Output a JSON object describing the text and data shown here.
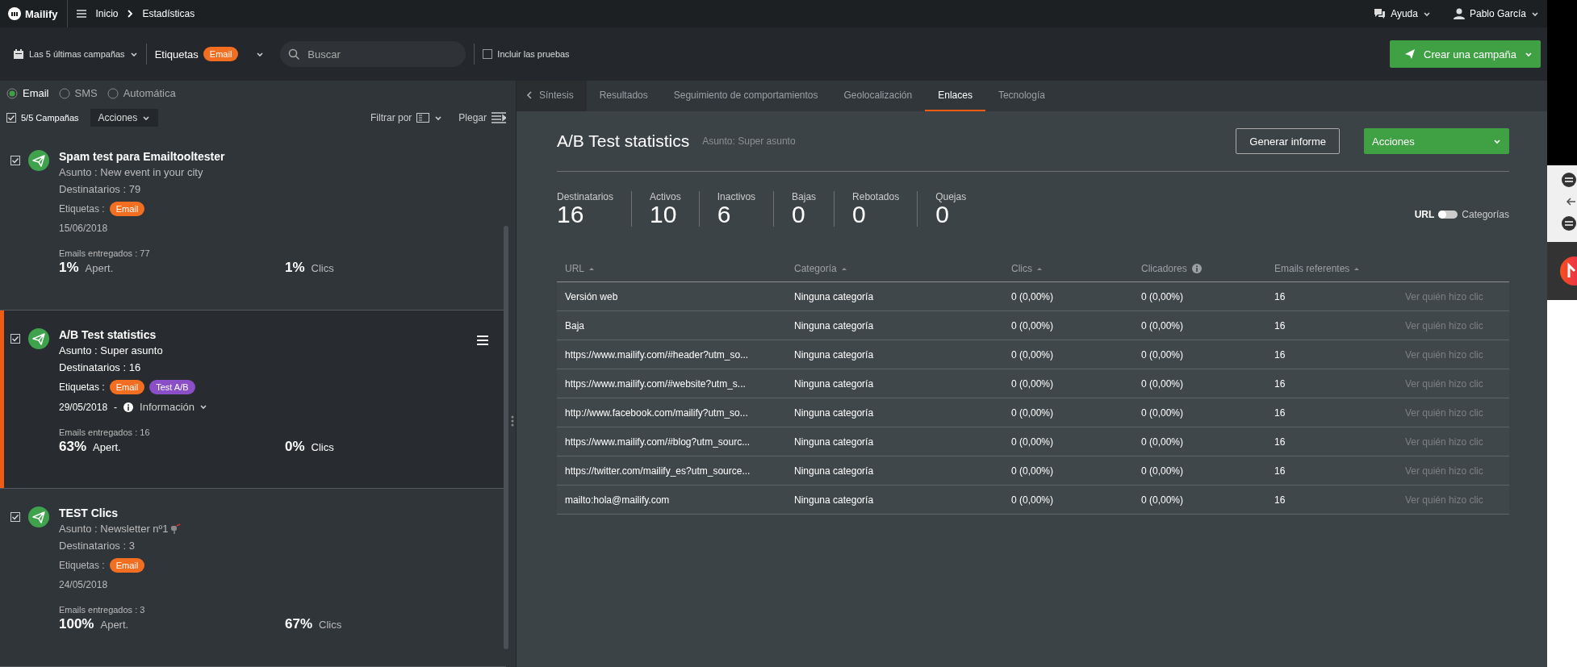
{
  "topbar": {
    "logo": "Mailify",
    "breadcrumb": [
      "Inicio",
      "Estadísticas"
    ],
    "help": "Ayuda",
    "user": "Pablo García"
  },
  "toolbar": {
    "period": "Las 5 últimas campañas",
    "tags_label": "Etiquetas",
    "tag": {
      "label": "Email",
      "color": "#f26f21"
    },
    "search": {
      "placeholder": "Buscar"
    },
    "include_tests": {
      "label": "Incluir las pruebas",
      "checked": false
    },
    "create_button": "Crear una campaña"
  },
  "channel_filter": [
    {
      "label": "Email",
      "selected": true
    },
    {
      "label": "SMS",
      "selected": false
    },
    {
      "label": "Automática",
      "selected": false
    }
  ],
  "list_header": {
    "count": "5/5 Campañas",
    "checked": true,
    "actions": "Acciones",
    "filter": "Filtrar por",
    "collapse": "Plegar"
  },
  "campaigns": [
    {
      "title": "Spam test para Emailtooltester",
      "subject": "Asunto : New event in your city",
      "subject_icon": false,
      "recipients": "Destinatarios : 79",
      "tags_label": "Etiquetas :",
      "tags": [
        {
          "label": "Email",
          "color": "#f26f21"
        }
      ],
      "date": "15/06/2018",
      "delivered": "Emails entregados : 77",
      "open_rate": "1%",
      "open_label": "Apert.",
      "click_rate": "1%",
      "click_label": "Clics",
      "checked": true,
      "selected": false
    },
    {
      "title": "A/B Test statistics",
      "subject": "Asunto : Super asunto",
      "subject_icon": false,
      "recipients": "Destinatarios : 16",
      "tags_label": "Etiquetas :",
      "tags": [
        {
          "label": "Email",
          "color": "#f26f21"
        },
        {
          "label": "Test A/B",
          "color": "#8a4fc7"
        }
      ],
      "date": "29/05/2018",
      "date_separator": "-",
      "info": "Información",
      "delivered": "Emails entregados : 16",
      "open_rate": "63%",
      "open_label": "Apert.",
      "click_rate": "0%",
      "click_label": "Clics",
      "checked": true,
      "selected": true
    },
    {
      "title": "TEST Clics",
      "subject": "Asunto : Newsletter nº1",
      "subject_icon": true,
      "recipients": "Destinatarios : 3",
      "tags_label": "Etiquetas :",
      "tags": [
        {
          "label": "Email",
          "color": "#f26f21"
        }
      ],
      "date": "24/05/2018",
      "delivered": "Emails entregados : 3",
      "open_rate": "100%",
      "open_label": "Apert.",
      "click_rate": "67%",
      "click_label": "Clics",
      "checked": true,
      "selected": false
    }
  ],
  "tabs": [
    {
      "label": "Síntesis",
      "kind": "back",
      "selected": false
    },
    {
      "label": "Resultados",
      "kind": "tab",
      "selected": false
    },
    {
      "label": "Seguimiento de comportamientos",
      "kind": "tab",
      "selected": false
    },
    {
      "label": "Geolocalización",
      "kind": "tab",
      "selected": false
    },
    {
      "label": "Enlaces",
      "kind": "tab",
      "selected": true
    },
    {
      "label": "Tecnología",
      "kind": "tab",
      "selected": false
    }
  ],
  "report": {
    "title": "A/B Test statistics",
    "subject": "Asunto: Super asunto",
    "report_button": "Generar informe",
    "actions_button": "Acciones"
  },
  "stats": [
    {
      "label": "Destinatarios",
      "value": "16"
    },
    {
      "label": "Activos",
      "value": "10"
    },
    {
      "label": "Inactivos",
      "value": "6"
    },
    {
      "label": "Bajas",
      "value": "0"
    },
    {
      "label": "Rebotados",
      "value": "0"
    },
    {
      "label": "Quejas",
      "value": "0"
    }
  ],
  "view_toggle": {
    "left": "URL",
    "right": "Categorías",
    "on": false
  },
  "table": {
    "columns": [
      {
        "label": "URL",
        "kind": "sort"
      },
      {
        "label": "Categoría",
        "kind": "sort"
      },
      {
        "label": "Clics",
        "kind": "sort"
      },
      {
        "label": "Clicadores",
        "kind": "info"
      },
      {
        "label": "Emails referentes",
        "kind": "sort"
      }
    ],
    "rows": [
      {
        "url": "Versión web",
        "category": "Ninguna categoría",
        "clicks": "0 (0,00%)",
        "clickers": "0 (0,00%)",
        "referrers": "16",
        "action": "Ver quién hizo clic"
      },
      {
        "url": "Baja",
        "category": "Ninguna categoría",
        "clicks": "0 (0,00%)",
        "clickers": "0 (0,00%)",
        "referrers": "16",
        "action": "Ver quién hizo clic"
      },
      {
        "url": "https://www.mailify.com/#header?utm_so...",
        "category": "Ninguna categoría",
        "clicks": "0 (0,00%)",
        "clickers": "0 (0,00%)",
        "referrers": "16",
        "action": "Ver quién hizo clic"
      },
      {
        "url": "https://www.mailify.com/#website?utm_s...",
        "category": "Ninguna categoría",
        "clicks": "0 (0,00%)",
        "clickers": "0 (0,00%)",
        "referrers": "16",
        "action": "Ver quién hizo clic"
      },
      {
        "url": "http://www.facebook.com/mailify?utm_so...",
        "category": "Ninguna categoría",
        "clicks": "0 (0,00%)",
        "clickers": "0 (0,00%)",
        "referrers": "16",
        "action": "Ver quién hizo clic"
      },
      {
        "url": "https://www.mailify.com/#blog?utm_sourc...",
        "category": "Ninguna categoría",
        "clicks": "0 (0,00%)",
        "clickers": "0 (0,00%)",
        "referrers": "16",
        "action": "Ver quién hizo clic"
      },
      {
        "url": "https://twitter.com/mailify_es?utm_source...",
        "category": "Ninguna categoría",
        "clicks": "0 (0,00%)",
        "clickers": "0 (0,00%)",
        "referrers": "16",
        "action": "Ver quién hizo clic"
      },
      {
        "url": "mailto:hola@mailify.com",
        "category": "Ninguna categoría",
        "clicks": "0 (0,00%)",
        "clickers": "0 (0,00%)",
        "referrers": "16",
        "action": "Ver quién hizo clic"
      }
    ]
  }
}
